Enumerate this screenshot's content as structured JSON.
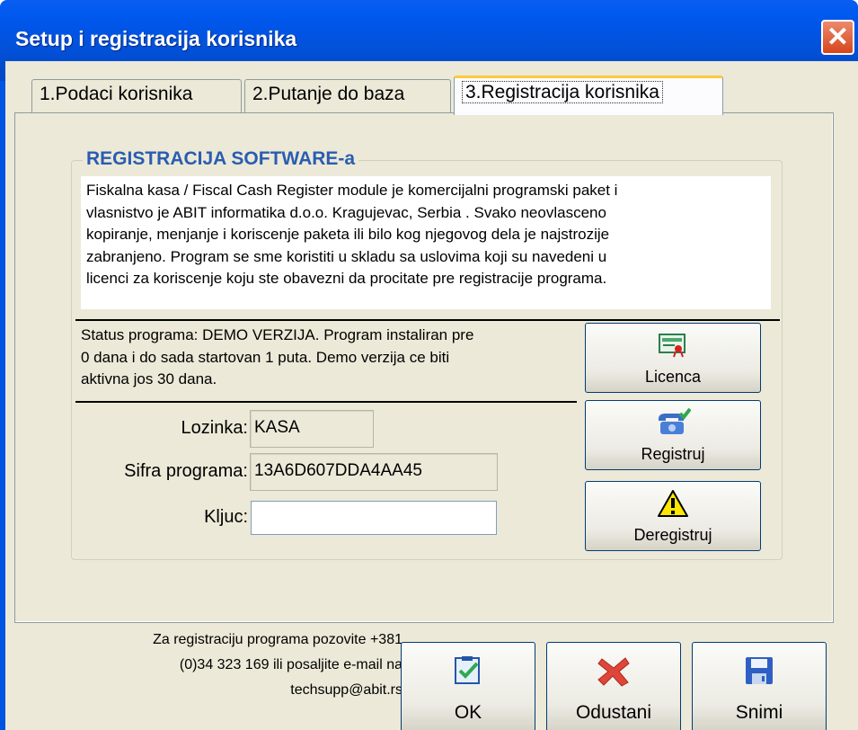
{
  "window": {
    "title": "Setup i registracija korisnika"
  },
  "tabs": [
    {
      "label": "1.Podaci korisnika"
    },
    {
      "label": "2.Putanje do baza"
    },
    {
      "label": "3.Registracija korisnika"
    }
  ],
  "group": {
    "title": "REGISTRACIJA SOFTWARE-a",
    "license_lines": [
      "Fiskalna kasa / Fiscal Cash Register module je komercijalni programski paket i",
      "vlasnistvo je ABIT informatika d.o.o.  Kragujevac, Serbia . Svako neovlasceno",
      "kopiranje, menjanje i koriscenje paketa ili bilo kog njegovog dela je najstrozije",
      "zabranjeno. Program se sme koristiti u skladu sa uslovima koji su navedeni u",
      "licenci za koriscenje koju ste obavezni da procitate pre registracije programa."
    ],
    "status_lines": [
      "Status programa: DEMO VERZIJA. Program instaliran pre",
      "0 dana i do sada startovan 1 puta. Demo verzija ce biti",
      "aktivna jos 30 dana."
    ]
  },
  "fields": {
    "lozinka": {
      "label": "Lozinka:",
      "value": "KASA"
    },
    "sifra": {
      "label": "Sifra programa:",
      "value": "13A6D607DDA4AA45"
    },
    "kljuc": {
      "label": "Kljuc:",
      "value": ""
    }
  },
  "side_buttons": {
    "licenca": "Licenca",
    "registruj": "Registruj",
    "deregistruj": "Deregistruj"
  },
  "footer": {
    "contact_lines": [
      "Za registraciju programa pozovite +381",
      "(0)34 323 169 ili posaljite e-mail na",
      "techsupp@abit.rs"
    ],
    "ok": "OK",
    "odustani": "Odustani",
    "snimi": "Snimi"
  },
  "colors": {
    "titlebar": "#0054e3",
    "group_title": "#2a5db0",
    "close": "#d6451d"
  }
}
